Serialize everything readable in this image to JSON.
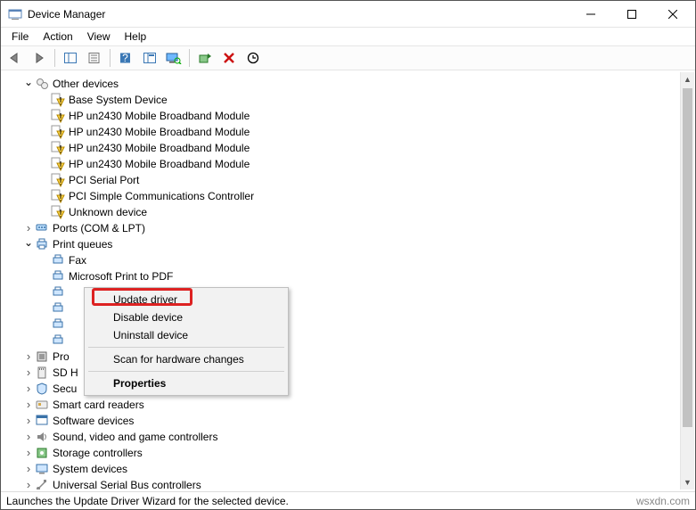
{
  "window": {
    "title": "Device Manager"
  },
  "menu": {
    "file": "File",
    "action": "Action",
    "view": "View",
    "help": "Help"
  },
  "tree": {
    "other_devices": "Other devices",
    "base_system": "Base System Device",
    "hp_bb": "HP un2430 Mobile Broadband Module",
    "pci_serial": "PCI Serial Port",
    "pci_simple": "PCI Simple Communications Controller",
    "unknown": "Unknown device",
    "ports": "Ports (COM & LPT)",
    "print_queues": "Print queues",
    "fax": "Fax",
    "ms_pdf": "Microsoft Print to PDF",
    "processors": "Pro",
    "sd_host": "SD H",
    "security": "Secu",
    "smart_card": "Smart card readers",
    "software": "Software devices",
    "sound": "Sound, video and game controllers",
    "storage": "Storage controllers",
    "system": "System devices",
    "usb": "Universal Serial Bus controllers"
  },
  "context": {
    "update": "Update driver",
    "disable": "Disable device",
    "uninstall": "Uninstall device",
    "scan": "Scan for hardware changes",
    "properties": "Properties"
  },
  "status": {
    "text": "Launches the Update Driver Wizard for the selected device.",
    "attrib": "wsxdn.com"
  }
}
